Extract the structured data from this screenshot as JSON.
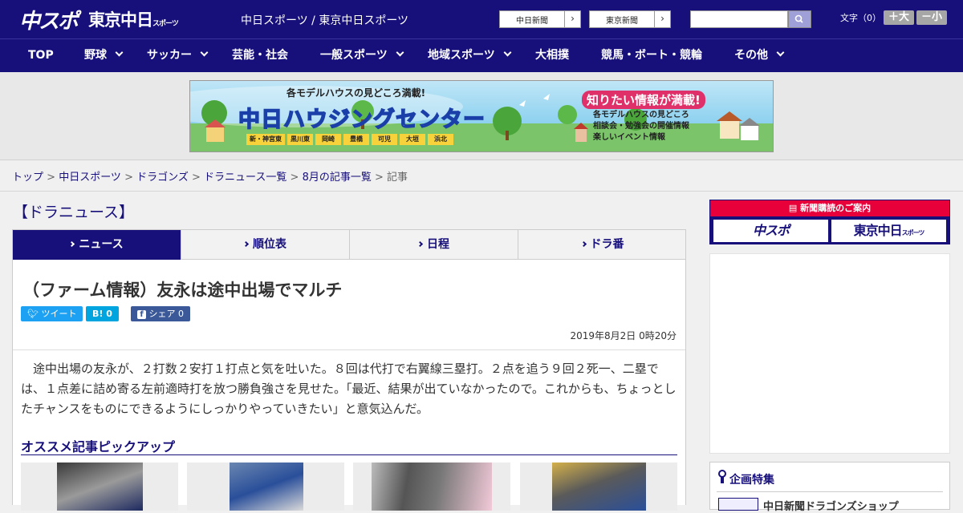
{
  "header": {
    "logo_chuspo": "中スポ",
    "logo_tokyo": "東京中日",
    "logo_tokyo_small": "スポーツ",
    "tagline": "中日スポーツ / 東京中日スポーツ",
    "ext_links": [
      "中日新聞",
      "東京新聞"
    ],
    "search_placeholder": "",
    "fontsize_label": "文字（0）",
    "fontsize_up": "＋大",
    "fontsize_down": "－小"
  },
  "nav": {
    "items": [
      {
        "label": "TOP"
      },
      {
        "label": "野球"
      },
      {
        "label": "サッカー"
      },
      {
        "label": "芸能・社会"
      },
      {
        "label": "一般スポーツ"
      },
      {
        "label": "地域スポーツ"
      },
      {
        "label": "大相撲"
      },
      {
        "label": "競馬・ボート・競輪"
      },
      {
        "label": "その他"
      }
    ]
  },
  "banner": {
    "tagline": "各モデルハウスの見どころ満載!",
    "title": "中日ハウジングセンター",
    "callout": "知りたい情報が満載!",
    "points": [
      "各モデルハウスの見どころ",
      "相談会・勉強会の開催情報",
      "楽しいイベント情報"
    ],
    "locations": [
      "新・神宮東",
      "黒川東",
      "岡崎",
      "豊橋",
      "可児",
      "大垣",
      "浜北"
    ]
  },
  "breadcrumb": {
    "items": [
      "トップ",
      "中日スポーツ",
      "ドラゴンズ",
      "ドラニュース一覧",
      "8月の記事一覧"
    ],
    "current": "記事",
    "sep": " > "
  },
  "section_title": "【ドラニュース】",
  "tabs": [
    "ニュース",
    "順位表",
    "日程",
    "ドラ番"
  ],
  "article": {
    "headline": "（ファーム情報）友永は途中出場でマルチ",
    "share": {
      "tweet": "ツイート",
      "hatena": "B! 0",
      "facebook": "シェア 0"
    },
    "date": "2019年8月2日 0時20分",
    "body": "　途中出場の友永が、２打数２安打１打点と気を吐いた。８回は代打で右翼線三塁打。２点を追う９回２死一、二塁では、１点差に詰め寄る左前適時打を放つ勝負強さを見せた。「最近、結果が出ていなかったので。これからも、ちょっとしたチャンスをものにできるようにしっかりやっていきたい」と意気込んだ。"
  },
  "pickup": {
    "title": "オススメ記事ピックアップ"
  },
  "sidebar": {
    "subscribe_head": "新聞購読のご案内",
    "subscribe_chuspo": "中スポ",
    "subscribe_tokyo": "東京中日",
    "subscribe_tokyo_small": "スポーツ",
    "feature_title": "企画特集",
    "feature_item": "中日新聞ドラゴンズショップ"
  },
  "colors": {
    "brand": "#17107a",
    "accent": "#e8003a",
    "twitter": "#1da1f2",
    "hatena": "#00a4de",
    "facebook": "#3b5998"
  }
}
